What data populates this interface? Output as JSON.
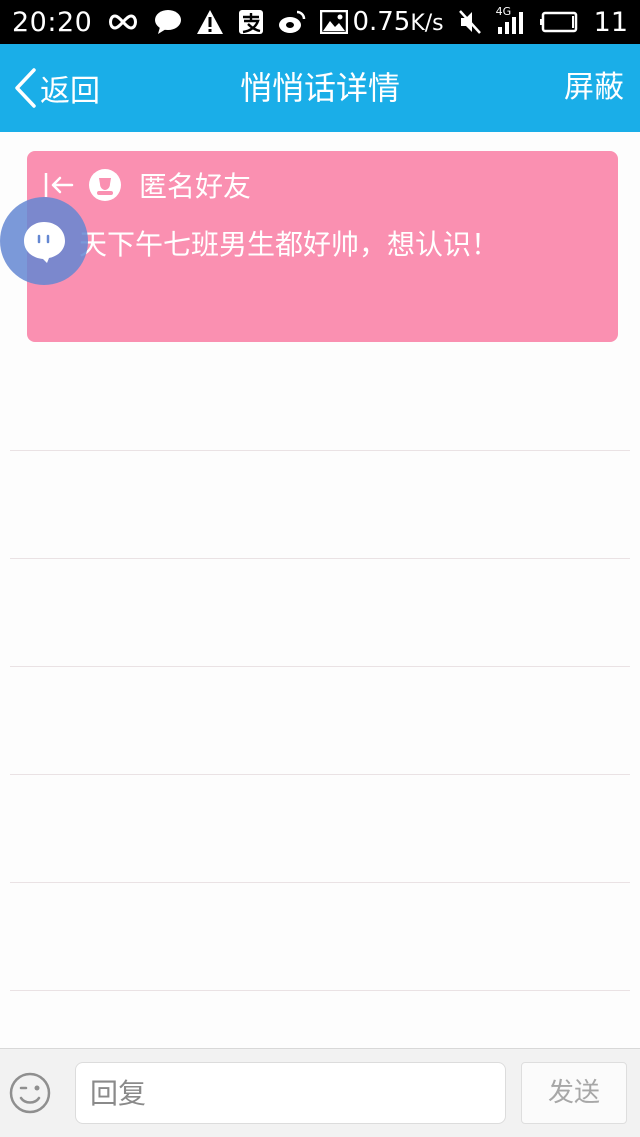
{
  "status_bar": {
    "time": "20:20",
    "speed_value": "0.75",
    "speed_unit": "K/s",
    "network": "4G",
    "battery_level": "11",
    "icons": [
      "infinity-icon",
      "chat-icon",
      "warning-icon",
      "alipay-icon",
      "weibo-icon",
      "image-icon",
      "mute-icon",
      "signal-icon",
      "battery-icon"
    ]
  },
  "header": {
    "back_label": "返回",
    "title": "悄悄话详情",
    "block_label": "屏蔽"
  },
  "message": {
    "sender": "匿名好友",
    "text": "天下午七班男生都好帅，想认识！",
    "card_color": "#fa90b1"
  },
  "composer": {
    "placeholder": "回复",
    "send_label": "发送"
  },
  "colors": {
    "accent": "#1aaee8",
    "card": "#fa90b1",
    "floating_bubble": "#6487d2"
  }
}
